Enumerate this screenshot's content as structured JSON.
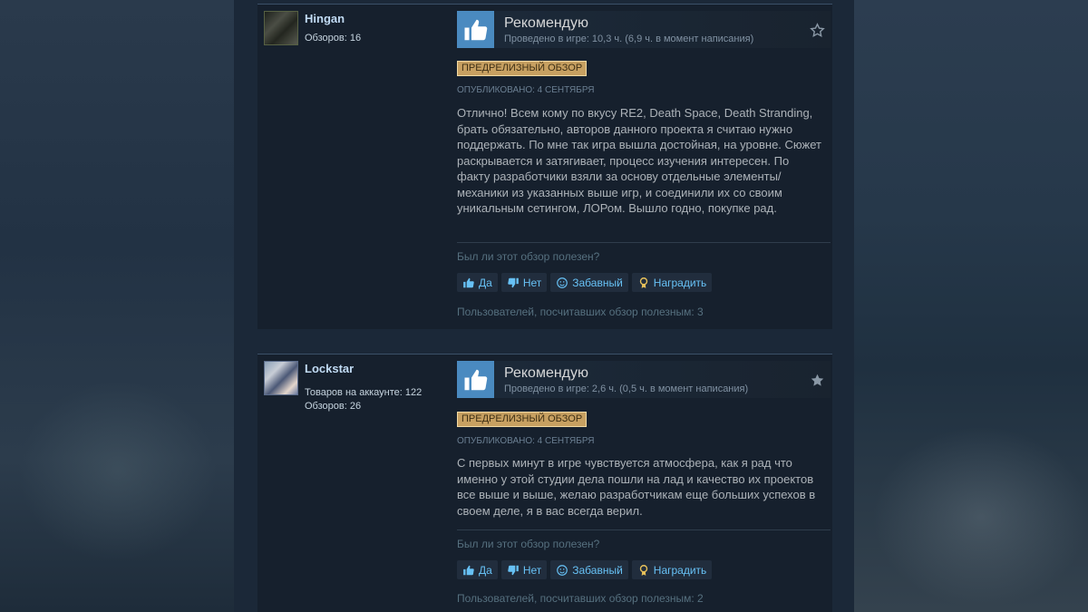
{
  "colors": {
    "page_bg": "#1b2838",
    "card_bg": "#16202d",
    "link_blue": "#67c1f5",
    "author_blue": "#c1dbf4",
    "badge_gold": "#c7a061",
    "thumb_blue": "#4a8ac0"
  },
  "reviews": [
    {
      "author": {
        "name": "Hingan",
        "reviews_count": "Обзоров: 16"
      },
      "verdict": "Рекомендую",
      "hours": "Проведено в игре: 10,3 ч. (6,9 ч. в момент написания)",
      "badge": "ПРЕДРЕЛИЗНЫЙ ОБЗОР",
      "posted": "ОПУБЛИКОВАНО: 4 СЕНТЯБРЯ",
      "text": "Отлично! Всем кому по вкусу RE2, Death Space, Death Stranding, брать обязательно, авторов данного проекта я считаю нужно поддержать. По мне так игра вышла достойная, на уровне. Сюжет раскрывается и затягивает, процесс изучения интересен. По факту разработчики взяли за основу отдельные элементы/механики из указанных выше игр, и соединили их со своим уникальным сетингом, ЛОРом. Вышло годно, покупке рад.",
      "helpful_question": "Был ли этот обзор полезен?",
      "buttons": {
        "yes": "Да",
        "no": "Нет",
        "funny": "Забавный",
        "award": "Наградить"
      },
      "helpful_count": "Пользователей, посчитавших обзор полезным: 3",
      "award_star": "star-outline-icon"
    },
    {
      "author": {
        "name": "Lockstar",
        "products": "Товаров на аккаунте: 122",
        "reviews_count": "Обзоров: 26"
      },
      "verdict": "Рекомендую",
      "hours": "Проведено в игре: 2,6 ч. (0,5 ч. в момент написания)",
      "badge": "ПРЕДРЕЛИЗНЫЙ ОБЗОР",
      "posted": "ОПУБЛИКОВАНО: 4 СЕНТЯБРЯ",
      "text": "С первых минут в игре чувствуется атмосфера, как я рад что именно у этой студии дела пошли на лад и качество их проектов все выше и выше, желаю разработчикам еще больших успехов в своем деле, я в вас всегда верил.",
      "helpful_question": "Был ли этот обзор полезен?",
      "buttons": {
        "yes": "Да",
        "no": "Нет",
        "funny": "Забавный",
        "award": "Наградить"
      },
      "helpful_count": "Пользователей, посчитавших обзор полезным: 2",
      "award_star": "star-filled-icon"
    }
  ]
}
